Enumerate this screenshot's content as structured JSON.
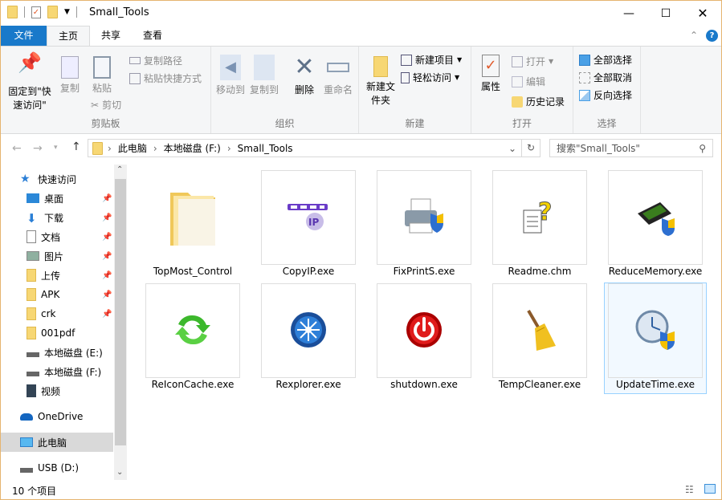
{
  "window": {
    "title": "Small_Tools",
    "controls": [
      "minimize",
      "maximize",
      "close"
    ]
  },
  "tabs": [
    {
      "label": "文件"
    },
    {
      "label": "主页"
    },
    {
      "label": "共享"
    },
    {
      "label": "查看"
    }
  ],
  "ribbon": {
    "clipboard": {
      "label": "剪贴板",
      "pin": "固定到\"快速访问\"",
      "copy": "复制",
      "paste": "粘贴",
      "copy_path": "复制路径",
      "paste_shortcut": "粘贴快捷方式",
      "cut": "剪切"
    },
    "organize": {
      "label": "组织",
      "move_to": "移动到",
      "copy_to": "复制到",
      "delete": "删除",
      "rename": "重命名"
    },
    "new": {
      "label": "新建",
      "new_folder": "新建文件夹",
      "new_item": "新建项目",
      "easy_access": "轻松访问"
    },
    "open": {
      "label": "打开",
      "properties": "属性",
      "open": "打开",
      "edit": "编辑",
      "history": "历史记录"
    },
    "select": {
      "label": "选择",
      "select_all": "全部选择",
      "select_none": "全部取消",
      "invert": "反向选择"
    }
  },
  "address": {
    "path": [
      "此电脑",
      "本地磁盘 (F:)",
      "Small_Tools"
    ],
    "search_placeholder": "搜索\"Small_Tools\""
  },
  "nav": [
    {
      "label": "快速访问",
      "icon": "star-icon"
    },
    {
      "label": "桌面",
      "icon": "desktop-icon",
      "pinned": true
    },
    {
      "label": "下载",
      "icon": "download-icon",
      "pinned": true
    },
    {
      "label": "文档",
      "icon": "document-icon",
      "pinned": true
    },
    {
      "label": "图片",
      "icon": "pictures-icon",
      "pinned": true
    },
    {
      "label": "上传",
      "icon": "folder-icon",
      "pinned": true
    },
    {
      "label": "APK",
      "icon": "folder-icon",
      "pinned": true
    },
    {
      "label": "crk",
      "icon": "folder-icon",
      "pinned": true
    },
    {
      "label": "001pdf",
      "icon": "folder-icon"
    },
    {
      "label": "本地磁盘 (E:)",
      "icon": "drive-icon"
    },
    {
      "label": "本地磁盘 (F:)",
      "icon": "drive-icon"
    },
    {
      "label": "视频",
      "icon": "video-icon"
    },
    {
      "label": "OneDrive",
      "icon": "cloud-icon"
    },
    {
      "label": "此电脑",
      "icon": "computer-icon",
      "selected": true
    },
    {
      "label": "USB (D:)",
      "icon": "drive-icon"
    }
  ],
  "files": [
    {
      "name": "TopMost_Control",
      "icon": "folder-icon"
    },
    {
      "name": "CopyIP.exe",
      "icon": "ip-icon"
    },
    {
      "name": "FixPrintS.exe",
      "icon": "printer-shield-icon"
    },
    {
      "name": "Readme.chm",
      "icon": "help-doc-icon"
    },
    {
      "name": "ReduceMemory.exe",
      "icon": "ram-shield-icon"
    },
    {
      "name": "ReIconCache.exe",
      "icon": "refresh-icon"
    },
    {
      "name": "Rexplorer.exe",
      "icon": "explorer-icon"
    },
    {
      "name": "shutdown.exe",
      "icon": "power-icon"
    },
    {
      "name": "TempCleaner.exe",
      "icon": "broom-icon"
    },
    {
      "name": "UpdateTime.exe",
      "icon": "clock-shield-icon",
      "selected": true
    }
  ],
  "status": {
    "count": "10 个项目"
  },
  "colors": {
    "accent": "#1979ca",
    "selection": "#cce8ff",
    "border": "#e5b46f"
  }
}
